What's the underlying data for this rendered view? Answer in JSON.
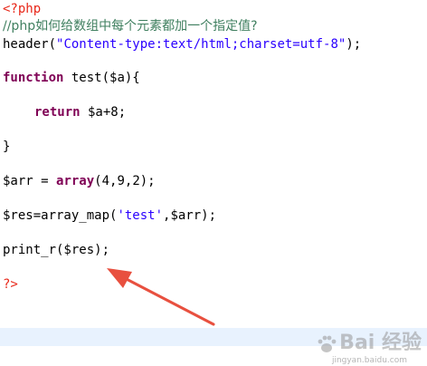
{
  "code": {
    "php_open": "<?php",
    "comment": "//php如何给数组中每个元素都加一个指定值?",
    "header_fn": "header(",
    "header_arg": "\"Content-type:text/html;charset=utf-8\"",
    "header_close": ");",
    "function_kw": "function",
    "function_sig": " test($a){",
    "return_kw": "return",
    "return_expr": " $a+8;",
    "close_brace": "}",
    "arr_lhs": "$arr = ",
    "array_kw": "array",
    "arr_rhs": "(4,9,2);",
    "res_start": "$res=array_map(",
    "res_str": "'test'",
    "res_end": ",$arr);",
    "print_line": "print_r($res);",
    "php_close": "?>"
  },
  "watermark": {
    "brand": "Bai  经验",
    "url": "jingyan.baidu.com"
  },
  "colors": {
    "php_tag": "#e8281a",
    "comment": "#3f7f5f",
    "keyword": "#7f0055",
    "string": "#2a00ff",
    "arrow": "#e8503f"
  }
}
